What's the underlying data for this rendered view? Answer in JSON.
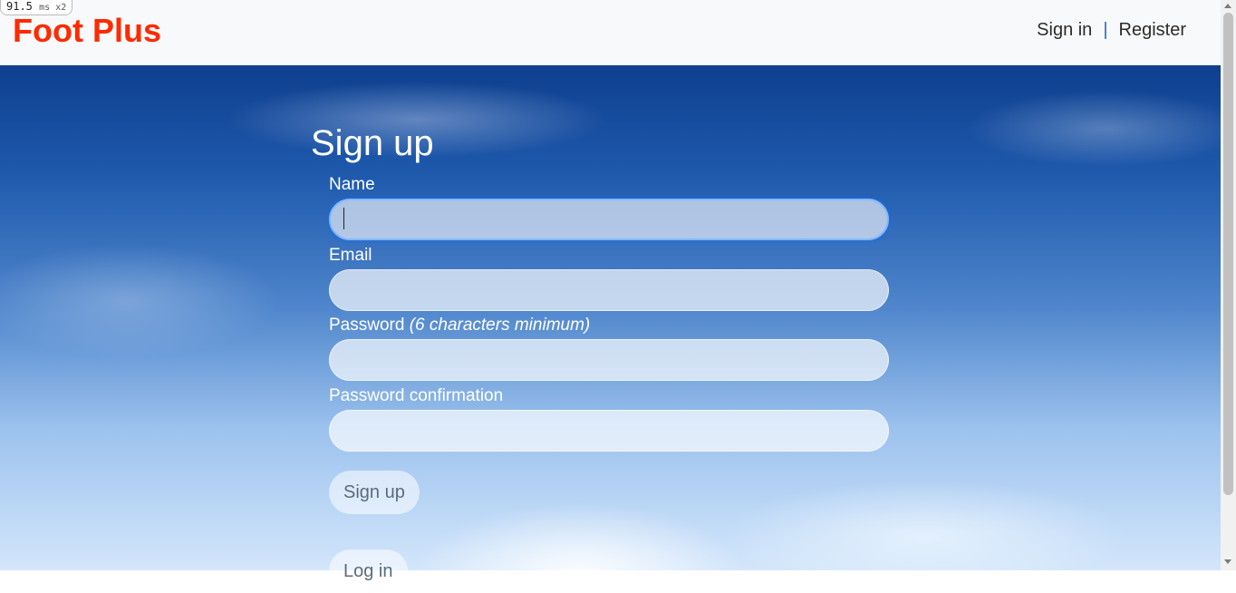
{
  "perf": {
    "value": "91.5",
    "unit": "ms x2"
  },
  "brand": "Foot Plus",
  "nav": {
    "sign_in": "Sign in",
    "separator": "|",
    "register": "Register"
  },
  "form": {
    "title": "Sign up",
    "name_label": "Name",
    "name_value": "",
    "email_label": "Email",
    "email_value": "",
    "password_label": "Password",
    "password_hint": "(6 characters minimum)",
    "password_value": "",
    "password_confirmation_label": "Password confirmation",
    "password_confirmation_value": "",
    "submit_label": "Sign up",
    "login_label": "Log in"
  },
  "colors": {
    "brand": "#ff2a00",
    "nav_separator": "#1e6bc7",
    "focus_ring": "#86b7fe"
  }
}
